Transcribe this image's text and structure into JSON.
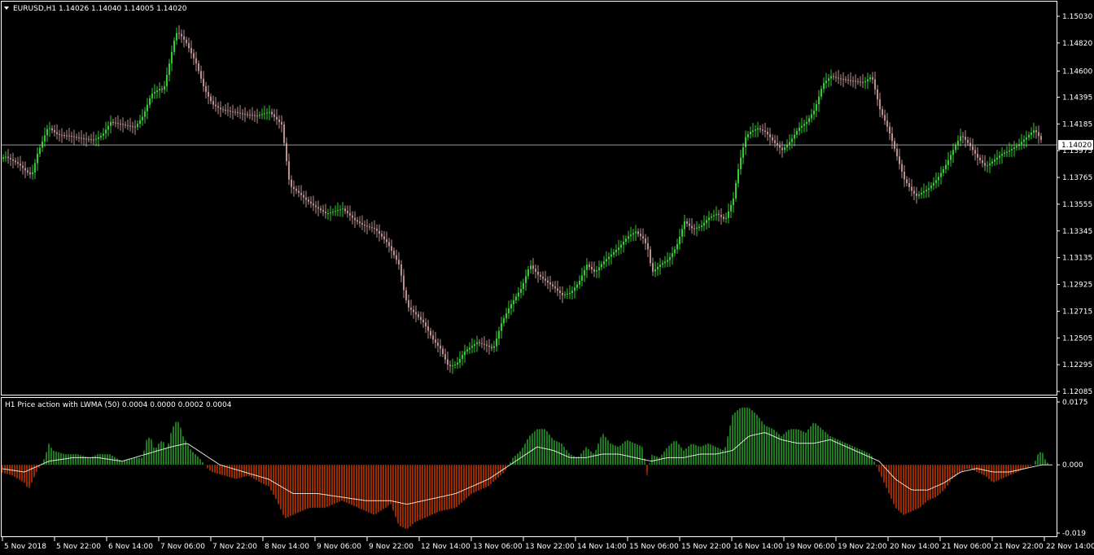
{
  "header": {
    "symbol_line": "EURUSD,H1  1.14026 1.14040 1.14005 1.14020",
    "indicator_line": "H1 Price action with LWMA (50) 0.0004 0.0000 0.0002 0.0004"
  },
  "colors": {
    "background": "#000000",
    "bull": "#32cd32",
    "bear": "#bc8f8f",
    "hist_pos": "#32cd32",
    "hist_neg": "#ff4500",
    "lwma": "#ffffff",
    "price_line": "#c0c0c0"
  },
  "chart_data": [
    {
      "type": "candlestick",
      "title": "EURUSD,H1",
      "ohlc_current": {
        "open": 1.14026,
        "high": 1.1404,
        "low": 1.14005,
        "close": 1.1402
      },
      "current_price_label": "1.14020",
      "y_ticks": [
        "1.15030",
        "1.14820",
        "1.14600",
        "1.14395",
        "1.14185",
        "1.13975",
        "1.13765",
        "1.13555",
        "1.13345",
        "1.13135",
        "1.12925",
        "1.12715",
        "1.12505",
        "1.12295",
        "1.12085"
      ],
      "ylim": [
        1.12085,
        1.1503
      ],
      "close_path": {
        "x": [
          0,
          5,
          14,
          22,
          30,
          38,
          45,
          58,
          70,
          85,
          100,
          115,
          125,
          135,
          150,
          165,
          175,
          185,
          195,
          200,
          205,
          210,
          215,
          220,
          228,
          240,
          250,
          260,
          270,
          285,
          300,
          315,
          330,
          345,
          350,
          355,
          365,
          375,
          385,
          400,
          420,
          435,
          445,
          460,
          475,
          490,
          495,
          500,
          510,
          520,
          530,
          540,
          550,
          560,
          570,
          585,
          595,
          605,
          615,
          625,
          640,
          650,
          660,
          670,
          680,
          690,
          700,
          710,
          720,
          730,
          740,
          750,
          760,
          770,
          780,
          790,
          795,
          800,
          810,
          820,
          830,
          840,
          850,
          860,
          870,
          880,
          890,
          900,
          905,
          910,
          915,
          920,
          930,
          940,
          950,
          960,
          970,
          980,
          990,
          1000,
          1010,
          1020,
          1030,
          1040,
          1050,
          1060,
          1070,
          1080,
          1090,
          1100,
          1110,
          1120,
          1125,
          1130,
          1140,
          1150,
          1160,
          1170,
          1180,
          1190,
          1200,
          1210,
          1220,
          1230,
          1240,
          1250,
          1260,
          1270,
          1280,
          1290,
          1295
        ],
        "close": [
          1.1391,
          1.1393,
          1.139,
          1.1387,
          1.1382,
          1.1378,
          1.1395,
          1.1416,
          1.141,
          1.1409,
          1.1407,
          1.1406,
          1.141,
          1.142,
          1.1418,
          1.1416,
          1.1425,
          1.1442,
          1.1446,
          1.1445,
          1.146,
          1.1475,
          1.149,
          1.1489,
          1.1482,
          1.1466,
          1.1446,
          1.1434,
          1.143,
          1.1428,
          1.1426,
          1.1425,
          1.1428,
          1.1418,
          1.1394,
          1.137,
          1.1365,
          1.1359,
          1.1354,
          1.1348,
          1.1352,
          1.1343,
          1.1339,
          1.1336,
          1.1325,
          1.1307,
          1.1288,
          1.1275,
          1.1269,
          1.1262,
          1.125,
          1.1242,
          1.1228,
          1.123,
          1.124,
          1.1247,
          1.1245,
          1.1242,
          1.1262,
          1.1275,
          1.129,
          1.1308,
          1.13,
          1.1295,
          1.129,
          1.1284,
          1.1286,
          1.1294,
          1.1308,
          1.1302,
          1.131,
          1.1316,
          1.1322,
          1.133,
          1.1334,
          1.1328,
          1.132,
          1.1302,
          1.1308,
          1.1312,
          1.1322,
          1.1342,
          1.1336,
          1.1338,
          1.1345,
          1.1348,
          1.1343,
          1.136,
          1.138,
          1.1395,
          1.1408,
          1.1412,
          1.1415,
          1.1412,
          1.1404,
          1.1398,
          1.1405,
          1.1415,
          1.142,
          1.143,
          1.145,
          1.1456,
          1.1454,
          1.1453,
          1.1452,
          1.1451,
          1.1456,
          1.143,
          1.1415,
          1.1395,
          1.1375,
          1.1365,
          1.1362,
          1.1364,
          1.1368,
          1.1375,
          1.1385,
          1.1398,
          1.141,
          1.1402,
          1.1392,
          1.1385,
          1.139,
          1.1395,
          1.1398,
          1.1402,
          1.1408,
          1.1414,
          1.1404
        ]
      }
    },
    {
      "type": "area",
      "title": "H1 Price action with LWMA (50)",
      "values_line": "0.0004 0.0000 0.0002 0.0004",
      "y_ticks": [
        "0.0175",
        "0.000",
        "-0.019"
      ],
      "ylim": [
        -0.019,
        0.0175
      ],
      "histogram": {
        "x": [
          0,
          15,
          30,
          35,
          45,
          55,
          60,
          65,
          80,
          95,
          110,
          120,
          135,
          150,
          165,
          175,
          180,
          185,
          190,
          195,
          200,
          205,
          210,
          215,
          220,
          225,
          235,
          245,
          255,
          260,
          275,
          290,
          305,
          320,
          330,
          340,
          350,
          360,
          380,
          400,
          420,
          440,
          460,
          480,
          490,
          500,
          510,
          520,
          540,
          560,
          580,
          600,
          620,
          630,
          640,
          650,
          660,
          670,
          680,
          690,
          700,
          710,
          720,
          730,
          740,
          750,
          760,
          770,
          780,
          790,
          795,
          800,
          810,
          820,
          830,
          840,
          850,
          860,
          870,
          880,
          890,
          900,
          910,
          920,
          930,
          940,
          950,
          960,
          970,
          980,
          990,
          1000,
          1010,
          1020,
          1030,
          1040,
          1050,
          1060,
          1070,
          1080,
          1090,
          1100,
          1110,
          1120,
          1130,
          1140,
          1150,
          1160,
          1170,
          1180,
          1190,
          1200,
          1210,
          1220,
          1230,
          1240,
          1250,
          1260,
          1270,
          1275,
          1280,
          1285,
          1290
        ],
        "value": [
          -0.002,
          -0.003,
          -0.005,
          -0.007,
          -0.002,
          0.002,
          0.006,
          0.004,
          0.003,
          0.003,
          0.002,
          0.003,
          0.003,
          0.001,
          0.002,
          0.002,
          0.007,
          0.008,
          0.004,
          0.006,
          0.007,
          0.004,
          0.009,
          0.012,
          0.012,
          0.008,
          0.004,
          0.002,
          -0.001,
          -0.002,
          -0.003,
          -0.004,
          -0.003,
          -0.005,
          -0.006,
          -0.01,
          -0.015,
          -0.014,
          -0.012,
          -0.012,
          -0.01,
          -0.012,
          -0.014,
          -0.011,
          -0.017,
          -0.018,
          -0.016,
          -0.015,
          -0.013,
          -0.012,
          -0.008,
          -0.006,
          -0.002,
          0.002,
          0.004,
          0.008,
          0.01,
          0.01,
          0.007,
          0.006,
          0.003,
          0.002,
          0.005,
          0.003,
          0.009,
          0.006,
          0.005,
          0.007,
          0.006,
          0.005,
          -0.003,
          0.003,
          0.002,
          0.005,
          0.007,
          0.004,
          0.006,
          0.005,
          0.006,
          0.005,
          0.004,
          0.014,
          0.016,
          0.016,
          0.014,
          0.011,
          0.01,
          0.008,
          0.01,
          0.01,
          0.009,
          0.012,
          0.01,
          0.008,
          0.007,
          0.006,
          0.005,
          0.004,
          0.003,
          -0.002,
          -0.007,
          -0.012,
          -0.014,
          -0.013,
          -0.012,
          -0.01,
          -0.009,
          -0.007,
          -0.004,
          -0.002,
          -0.001,
          -0.002,
          -0.003,
          -0.005,
          -0.004,
          -0.003,
          -0.002,
          -0.001,
          0.0,
          0.003,
          0.004,
          0.001,
          0.0
        ]
      },
      "lwma": {
        "x": [
          0,
          30,
          60,
          90,
          120,
          150,
          180,
          210,
          230,
          250,
          270,
          300,
          330,
          360,
          390,
          420,
          450,
          480,
          500,
          520,
          540,
          560,
          580,
          600,
          620,
          640,
          660,
          680,
          700,
          720,
          740,
          760,
          780,
          800,
          820,
          840,
          860,
          880,
          900,
          920,
          940,
          960,
          980,
          1000,
          1020,
          1040,
          1060,
          1080,
          1100,
          1120,
          1140,
          1160,
          1180,
          1200,
          1220,
          1240,
          1260,
          1280,
          1290
        ],
        "value": [
          -0.001,
          -0.002,
          0.001,
          0.002,
          0.002,
          0.001,
          0.003,
          0.005,
          0.006,
          0.003,
          0.0,
          -0.002,
          -0.004,
          -0.008,
          -0.008,
          -0.009,
          -0.01,
          -0.01,
          -0.011,
          -0.01,
          -0.009,
          -0.008,
          -0.006,
          -0.004,
          -0.001,
          0.002,
          0.005,
          0.004,
          0.002,
          0.002,
          0.003,
          0.003,
          0.002,
          0.001,
          0.002,
          0.002,
          0.003,
          0.003,
          0.004,
          0.008,
          0.009,
          0.007,
          0.006,
          0.006,
          0.007,
          0.005,
          0.003,
          0.001,
          -0.004,
          -0.007,
          -0.007,
          -0.005,
          -0.002,
          -0.001,
          -0.002,
          -0.002,
          -0.001,
          0.0,
          0.0
        ]
      }
    }
  ],
  "x_ticks": [
    "5 Nov 2018",
    "5 Nov 22:00",
    "6 Nov 14:00",
    "7 Nov 06:00",
    "7 Nov 22:00",
    "8 Nov 14:00",
    "9 Nov 06:00",
    "9 Nov 22:00",
    "12 Nov 14:00",
    "13 Nov 06:00",
    "13 Nov 22:00",
    "14 Nov 14:00",
    "15 Nov 06:00",
    "15 Nov 22:00",
    "16 Nov 14:00",
    "19 Nov 06:00",
    "19 Nov 22:00",
    "20 Nov 14:00",
    "21 Nov 06:00",
    "21 Nov 22:00",
    "22 Nov 14:00"
  ]
}
